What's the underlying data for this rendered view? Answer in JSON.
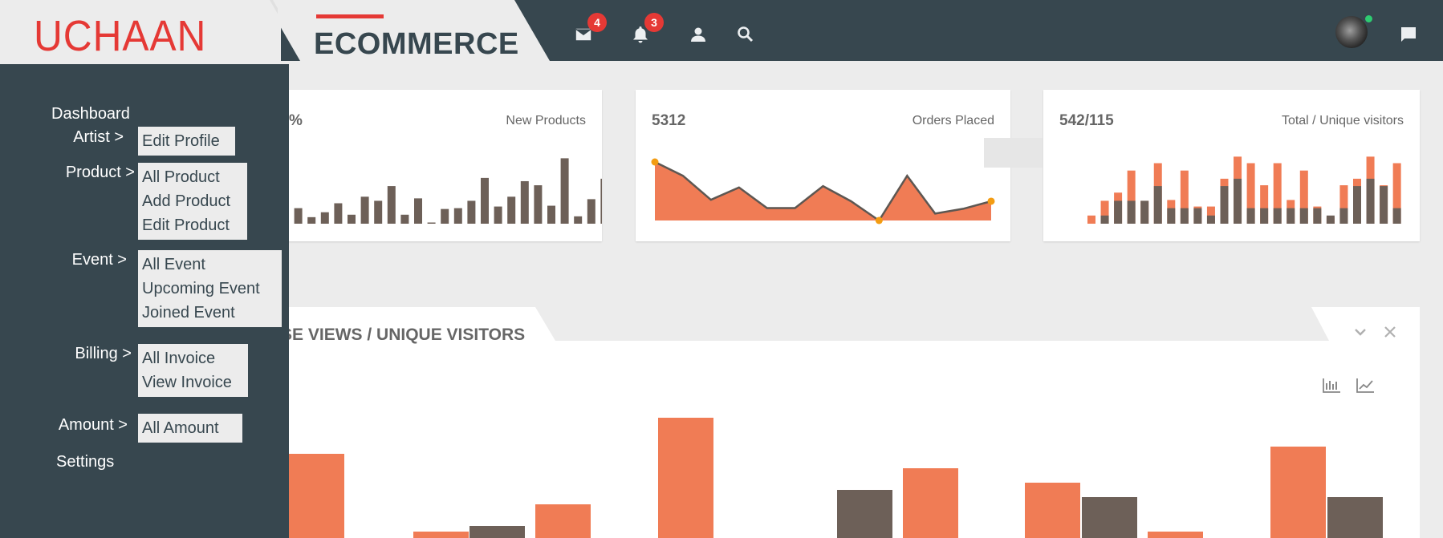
{
  "app": {
    "logo_text": "UCHAAN",
    "title": "ECOMMERCE"
  },
  "header": {
    "mail_badge": "4",
    "notification_badge": "3",
    "icons": [
      "mail-icon",
      "bell-icon",
      "user-icon",
      "search-icon",
      "avatar",
      "chat-icon"
    ]
  },
  "cards": [
    {
      "value": "%",
      "label": "New Products",
      "bars": [
        26,
        19,
        8,
        14,
        25,
        11,
        33,
        28,
        46,
        11,
        31,
        0,
        18,
        19,
        28,
        56,
        21,
        33,
        52,
        47,
        22,
        80,
        9,
        30,
        55,
        44,
        15,
        13,
        27,
        23,
        11,
        20,
        47
      ]
    },
    {
      "value": "5312",
      "label": "Orders Placed",
      "points": [
        85,
        65,
        30,
        48,
        18,
        18,
        50,
        28,
        0,
        65,
        10,
        17,
        28
      ]
    },
    {
      "value": "542/115",
      "label": "Total / Unique visitors",
      "bars_total": [
        10,
        28,
        38,
        65,
        28,
        74,
        29,
        65,
        21,
        21,
        55,
        82,
        74,
        47,
        74,
        29,
        65,
        21,
        8,
        47,
        55,
        82,
        47,
        74
      ],
      "bars_unique": [
        0,
        10,
        28,
        28,
        28,
        46,
        19,
        19,
        19,
        10,
        46,
        55,
        19,
        19,
        19,
        19,
        19,
        19,
        10,
        19,
        46,
        55,
        46,
        19
      ]
    }
  ],
  "panel": {
    "title": "SE VIEWS / UNIQUE VISITORS",
    "bars": [
      {
        "series": "views",
        "value": 105
      },
      {
        "series": "views",
        "value": 8
      },
      {
        "series": "unique",
        "value": 15
      },
      {
        "series": "views",
        "value": 42
      },
      {
        "series": "views",
        "value": 150
      },
      {
        "series": "unique",
        "value": 60
      },
      {
        "series": "views",
        "value": 87
      },
      {
        "series": "views",
        "value": 69
      },
      {
        "series": "unique",
        "value": 51
      },
      {
        "series": "views",
        "value": 8
      },
      {
        "series": "views",
        "value": 114
      },
      {
        "series": "unique",
        "value": 51
      }
    ]
  },
  "colors": {
    "accent": "#e53935",
    "orange": "#f07c55",
    "bar_dark": "#6d6058",
    "sidebar": "#37474f"
  },
  "sidebar": {
    "dashboard": "Dashboard",
    "settings": "Settings",
    "groups": [
      {
        "label": "Artist >",
        "items": [
          "Edit Profile"
        ]
      },
      {
        "label": "Product >",
        "items": [
          "All Product",
          "Add Product",
          "Edit Product"
        ]
      },
      {
        "label": "Event >",
        "items": [
          "All Event",
          "Upcoming Event",
          "Joined Event"
        ]
      },
      {
        "label": "Billing >",
        "items": [
          "All Invoice",
          "View Invoice"
        ]
      },
      {
        "label": "Amount >",
        "items": [
          "All Amount"
        ]
      }
    ]
  }
}
